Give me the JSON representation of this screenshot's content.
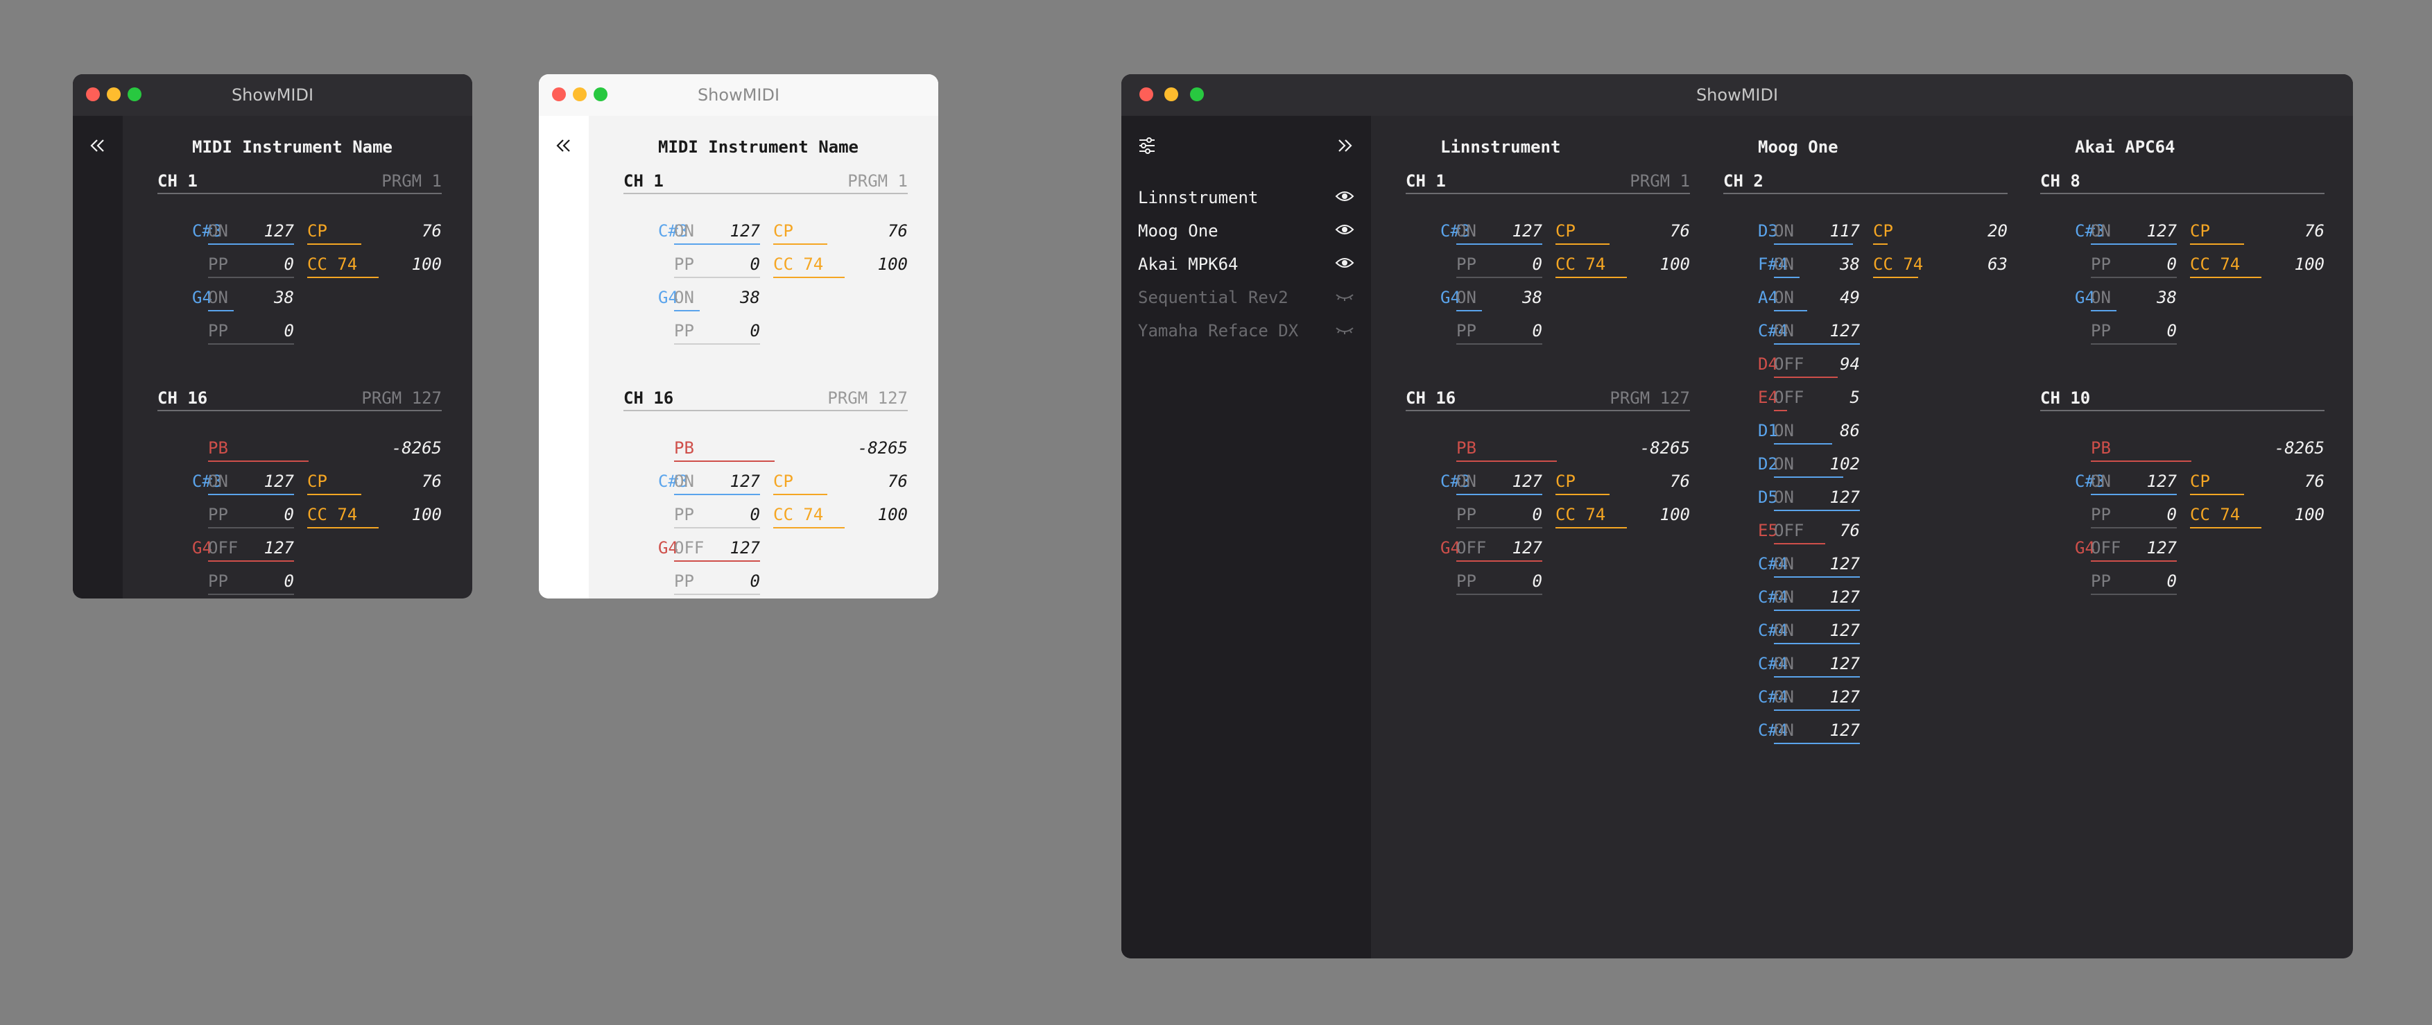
{
  "app": {
    "title": "ShowMIDI"
  },
  "colors": {
    "dark": {
      "text": "#f2f2f2",
      "dim": "#7c7c80",
      "hline": "#6c6c70",
      "on": "#5aa4ec",
      "off": "#cf4f4a",
      "cc": "#f5a623",
      "dim_line": "#56565a"
    },
    "light": {
      "text": "#1a1a1a",
      "dim": "#9a9a9a",
      "hline": "#bdbdbd",
      "on": "#5aa4ec",
      "off": "#cf4f4a",
      "cc": "#f5a623",
      "dim_line": "#cfcfcf"
    }
  },
  "sidebar": {
    "collapse_icon": "double-chevron-left-icon",
    "expand_icon": "double-chevron-right-icon",
    "settings_icon": "sliders-icon",
    "devices": [
      {
        "name": "Linnstrument",
        "visible": true
      },
      {
        "name": "Moog One",
        "visible": true
      },
      {
        "name": "Akai MPK64",
        "visible": true
      },
      {
        "name": "Sequential Rev2",
        "visible": false
      },
      {
        "name": "Yamaha Reface DX",
        "visible": false
      }
    ]
  },
  "instruments": {
    "generic": {
      "name": "MIDI Instrument Name",
      "channels": [
        {
          "label": "CH 1",
          "program": "PRGM 1",
          "rows": [
            {
              "note": "C#3",
              "note_kind": "on",
              "status": "ON",
              "value": "127",
              "cc_label": "CP",
              "cc_value": "76",
              "cc_fill": 0.6
            },
            {
              "note": "",
              "note_kind": "pp",
              "status": "PP",
              "value": "0",
              "cc_label": "CC 74",
              "cc_value": "100",
              "cc_fill": 0.79
            },
            {
              "note": "G4",
              "note_kind": "on",
              "status": "ON",
              "value": "38"
            },
            {
              "note": "",
              "note_kind": "pp",
              "status": "PP",
              "value": "0"
            }
          ]
        },
        {
          "label": "CH 16",
          "program": "PRGM 127",
          "pitchbend": {
            "label": "PB",
            "value": "-8265",
            "fill": 0.5
          },
          "rows": [
            {
              "note": "C#3",
              "note_kind": "on",
              "status": "ON",
              "value": "127",
              "cc_label": "CP",
              "cc_value": "76",
              "cc_fill": 0.6
            },
            {
              "note": "",
              "note_kind": "pp",
              "status": "PP",
              "value": "0",
              "cc_label": "CC 74",
              "cc_value": "100",
              "cc_fill": 0.79
            },
            {
              "note": "G4",
              "note_kind": "off",
              "status": "OFF",
              "value": "127"
            },
            {
              "note": "",
              "note_kind": "pp",
              "status": "PP",
              "value": "0"
            }
          ]
        }
      ]
    },
    "linnstrument": {
      "name": "Linnstrument",
      "channels": [
        {
          "label": "CH 1",
          "program": "PRGM 1",
          "rows": [
            {
              "note": "C#3",
              "note_kind": "on",
              "status": "ON",
              "value": "127",
              "cc_label": "CP",
              "cc_value": "76",
              "cc_fill": 0.6
            },
            {
              "note": "",
              "note_kind": "pp",
              "status": "PP",
              "value": "0",
              "cc_label": "CC 74",
              "cc_value": "100",
              "cc_fill": 0.79
            },
            {
              "note": "G4",
              "note_kind": "on",
              "status": "ON",
              "value": "38"
            },
            {
              "note": "",
              "note_kind": "pp",
              "status": "PP",
              "value": "0"
            }
          ]
        },
        {
          "label": "CH 16",
          "program": "PRGM 127",
          "pitchbend": {
            "label": "PB",
            "value": "-8265",
            "fill": 0.5
          },
          "rows": [
            {
              "note": "C#3",
              "note_kind": "on",
              "status": "ON",
              "value": "127",
              "cc_label": "CP",
              "cc_value": "76",
              "cc_fill": 0.6
            },
            {
              "note": "",
              "note_kind": "pp",
              "status": "PP",
              "value": "0",
              "cc_label": "CC 74",
              "cc_value": "100",
              "cc_fill": 0.79
            },
            {
              "note": "G4",
              "note_kind": "off",
              "status": "OFF",
              "value": "127"
            },
            {
              "note": "",
              "note_kind": "pp",
              "status": "PP",
              "value": "0"
            }
          ]
        }
      ]
    },
    "moog": {
      "name": "Moog One",
      "channels": [
        {
          "label": "CH 2",
          "program": "",
          "rows": [
            {
              "note": "D3",
              "note_kind": "on",
              "status": "ON",
              "value": "117",
              "cc_label": "CP",
              "cc_value": "20",
              "cc_fill": 0.16
            },
            {
              "note": "F#4",
              "note_kind": "on",
              "status": "ON",
              "value": "38",
              "cc_label": "CC 74",
              "cc_value": "63",
              "cc_fill": 0.5
            },
            {
              "note": "A4",
              "note_kind": "on",
              "status": "ON",
              "value": "49"
            },
            {
              "note": "C#4",
              "note_kind": "on",
              "status": "ON",
              "value": "127"
            },
            {
              "note": "D4",
              "note_kind": "off",
              "status": "OFF",
              "value": "94"
            },
            {
              "note": "E4",
              "note_kind": "off",
              "status": "OFF",
              "value": "5"
            },
            {
              "note": "D1",
              "note_kind": "on",
              "status": "ON",
              "value": "86"
            },
            {
              "note": "D2",
              "note_kind": "on",
              "status": "ON",
              "value": "102"
            },
            {
              "note": "D5",
              "note_kind": "on",
              "status": "ON",
              "value": "127"
            },
            {
              "note": "E5",
              "note_kind": "off",
              "status": "OFF",
              "value": "76"
            },
            {
              "note": "C#4",
              "note_kind": "on",
              "status": "ON",
              "value": "127"
            },
            {
              "note": "C#4",
              "note_kind": "on",
              "status": "ON",
              "value": "127"
            },
            {
              "note": "C#4",
              "note_kind": "on",
              "status": "ON",
              "value": "127"
            },
            {
              "note": "C#4",
              "note_kind": "on",
              "status": "ON",
              "value": "127"
            },
            {
              "note": "C#4",
              "note_kind": "on",
              "status": "ON",
              "value": "127"
            },
            {
              "note": "C#4",
              "note_kind": "on",
              "status": "ON",
              "value": "127"
            }
          ]
        }
      ]
    },
    "akai": {
      "name": "Akai APC64",
      "channels": [
        {
          "label": "CH 8",
          "program": "",
          "rows": [
            {
              "note": "C#3",
              "note_kind": "on",
              "status": "ON",
              "value": "127",
              "cc_label": "CP",
              "cc_value": "76",
              "cc_fill": 0.6
            },
            {
              "note": "",
              "note_kind": "pp",
              "status": "PP",
              "value": "0",
              "cc_label": "CC 74",
              "cc_value": "100",
              "cc_fill": 0.79
            },
            {
              "note": "G4",
              "note_kind": "on",
              "status": "ON",
              "value": "38"
            },
            {
              "note": "",
              "note_kind": "pp",
              "status": "PP",
              "value": "0"
            }
          ]
        },
        {
          "label": "CH 10",
          "program": "",
          "pitchbend": {
            "label": "PB",
            "value": "-8265",
            "fill": 0.5
          },
          "rows": [
            {
              "note": "C#3",
              "note_kind": "on",
              "status": "ON",
              "value": "127",
              "cc_label": "CP",
              "cc_value": "76",
              "cc_fill": 0.6
            },
            {
              "note": "",
              "note_kind": "pp",
              "status": "PP",
              "value": "0",
              "cc_label": "CC 74",
              "cc_value": "100",
              "cc_fill": 0.79
            },
            {
              "note": "G4",
              "note_kind": "off",
              "status": "OFF",
              "value": "127"
            },
            {
              "note": "",
              "note_kind": "pp",
              "status": "PP",
              "value": "0"
            }
          ]
        }
      ]
    }
  }
}
